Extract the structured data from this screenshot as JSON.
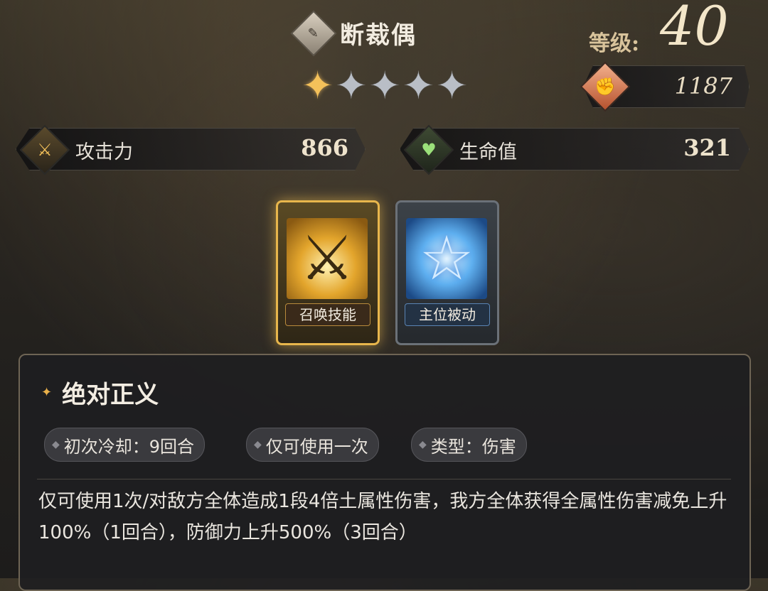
{
  "character": {
    "name": "断裁偶",
    "class_icon": "quill-icon",
    "stars_total": 5,
    "stars_filled": 1
  },
  "level": {
    "label": "等级:",
    "value": "40"
  },
  "power": {
    "icon": "fist-icon",
    "value": "1187"
  },
  "stats": {
    "attack": {
      "icon": "crossed-swords-icon",
      "label": "攻击力",
      "value": "866"
    },
    "hp": {
      "icon": "heart-icon",
      "label": "生命值",
      "value": "321"
    }
  },
  "skills": [
    {
      "tag": "召唤技能",
      "icon": "crossed-swords-icon",
      "selected": true
    },
    {
      "tag": "主位被动",
      "icon": "star-icon",
      "selected": false
    }
  ],
  "detail": {
    "skill_name": "绝对正义",
    "tags": [
      "初次冷却：9回合",
      "仅可使用一次",
      "类型：伤害"
    ],
    "description": "仅可使用1次/对敌方全体造成1段4倍土属性伤害，我方全体获得全属性伤害减免上升100%（1回合），防御力上升500%（3回合）"
  },
  "colors": {
    "gold_accent": "#e8b64c",
    "panel_border": "#6e6454",
    "hp_green": "#9be07a"
  }
}
